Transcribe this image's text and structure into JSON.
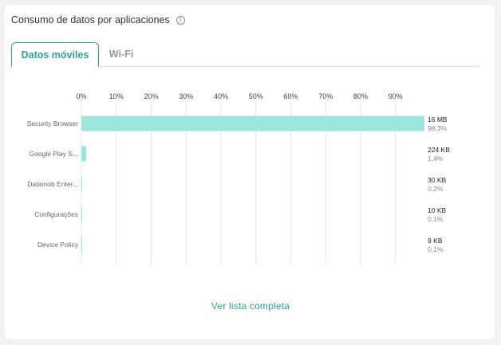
{
  "panel": {
    "title": "Consumo de datos por aplicaciones",
    "info_icon": "info-icon"
  },
  "tabs": [
    {
      "label": "Datos móviles",
      "active": true
    },
    {
      "label": "Wi-Fi",
      "active": false
    }
  ],
  "colors": {
    "accent": "#2fa58d",
    "bar": "#9de6dd",
    "grid": "#e4e4e4"
  },
  "chart_data": {
    "type": "bar",
    "orientation": "horizontal",
    "ticks": [
      "0%",
      "10%",
      "20%",
      "30%",
      "40%",
      "50%",
      "60%",
      "70%",
      "80%",
      "90%"
    ],
    "tick_values": [
      0,
      10,
      20,
      30,
      40,
      50,
      60,
      70,
      80,
      90
    ],
    "xlim": [
      0,
      98.3
    ],
    "grid": true,
    "categories": [
      "Security Browser",
      "Google Play S...",
      "Datamob Enter...",
      "Configurações",
      "Device Policy"
    ],
    "values": [
      98.3,
      1.4,
      0.2,
      0.1,
      0.1
    ],
    "sizes": [
      "16 MB",
      "224 KB",
      "30 KB",
      "10 KB",
      "9 KB"
    ],
    "percent_labels": [
      "98,3%",
      "1,4%",
      "0,2%",
      "0,1%",
      "0,1%"
    ]
  },
  "footer": {
    "link_label": "Ver lista completa"
  }
}
